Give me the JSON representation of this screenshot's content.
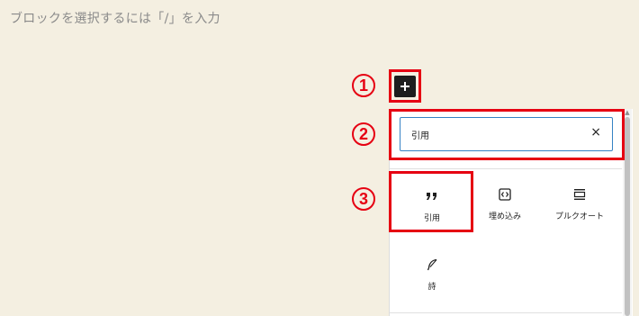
{
  "editor": {
    "placeholder": "ブロックを選択するには「/」を入力"
  },
  "annotations": {
    "step1": "1",
    "step2": "2",
    "step3": "3"
  },
  "inserter": {
    "search_value": "引用",
    "clear_label": "×",
    "blocks": [
      {
        "label": "引用",
        "icon": "quote-icon"
      },
      {
        "label": "埋め込み",
        "icon": "embed-icon"
      },
      {
        "label": "プルクオート",
        "icon": "pullquote-icon"
      },
      {
        "label": "詩",
        "icon": "verse-icon"
      }
    ]
  },
  "colors": {
    "annotation": "#e60012",
    "background": "#f4efe1",
    "search_border": "#3582c4"
  }
}
